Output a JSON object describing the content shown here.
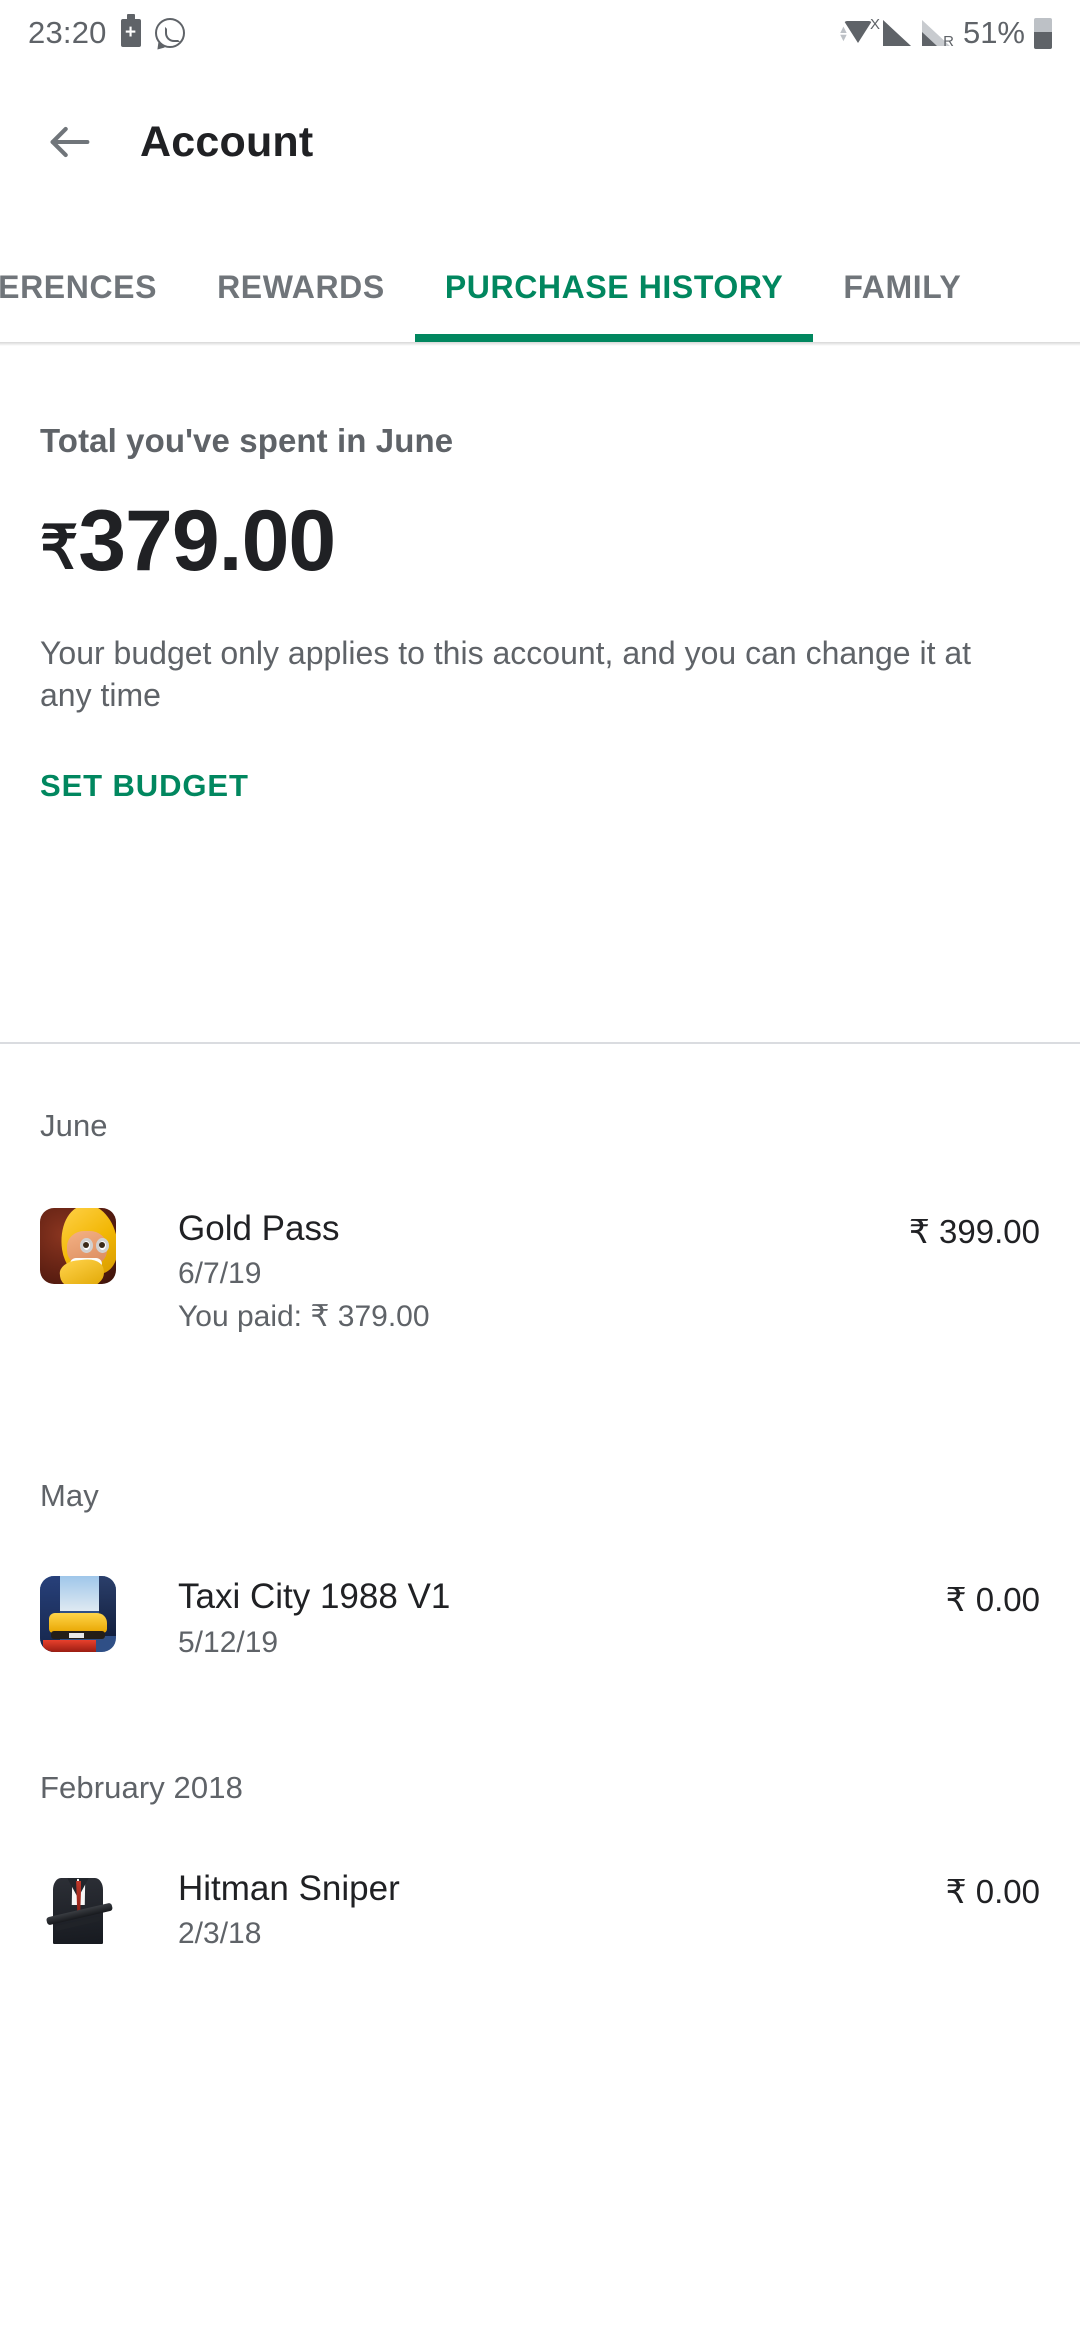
{
  "status_bar": {
    "time": "23:20",
    "battery_percent": "51%",
    "signal_x_label": "X",
    "signal_r_label": "R",
    "icons": [
      "battery-saver-icon",
      "whatsapp-icon",
      "wifi-icon",
      "signal-icon",
      "battery-icon"
    ]
  },
  "app_bar": {
    "back_icon": "back-arrow-icon",
    "title": "Account"
  },
  "tabs": [
    {
      "label": "FERENCES",
      "active": false
    },
    {
      "label": "REWARDS",
      "active": false
    },
    {
      "label": "PURCHASE HISTORY",
      "active": true
    },
    {
      "label": "FAMILY",
      "active": false
    }
  ],
  "budget": {
    "heading": "Total you've spent in June",
    "currency": "₹",
    "amount": "379.00",
    "description": "Your budget only applies to this account, and you can change it at any time",
    "action_label": "SET BUDGET"
  },
  "purchase_groups": [
    {
      "month": "June",
      "items": [
        {
          "icon": "clash-of-clans-icon",
          "title": "Gold Pass",
          "date": "6/7/19",
          "paid_note": "You paid: ₹ 379.00",
          "price": "₹ 399.00"
        }
      ]
    },
    {
      "month": "May",
      "items": [
        {
          "icon": "taxi-city-icon",
          "title": "Taxi City 1988 V1",
          "date": "5/12/19",
          "paid_note": "",
          "price": "₹ 0.00"
        }
      ]
    },
    {
      "month": "February 2018",
      "items": [
        {
          "icon": "hitman-sniper-icon",
          "title": "Hitman Sniper",
          "date": "2/3/18",
          "paid_note": "",
          "price": "₹ 0.00"
        }
      ]
    }
  ],
  "colors": {
    "accent_green": "#01875f",
    "primary_text": "#202124",
    "secondary_text": "#5f6368",
    "divider": "#dadce0"
  }
}
